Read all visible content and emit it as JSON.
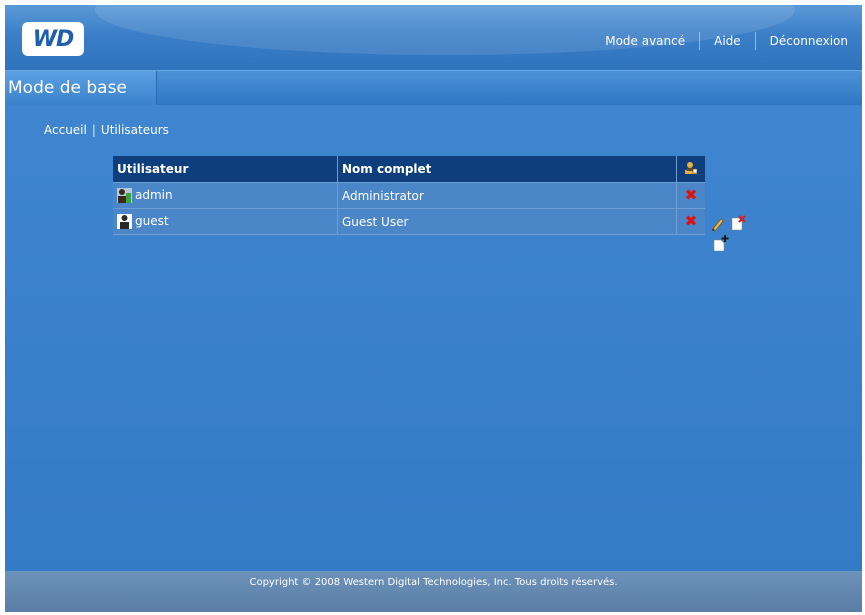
{
  "header": {
    "logo": "WD",
    "nav": [
      "Mode avancé",
      "Aide",
      "Déconnexion"
    ]
  },
  "tabs": [
    {
      "label": "Mode de base",
      "active": true
    }
  ],
  "breadcrumb": [
    "Accueil",
    "Utilisateurs"
  ],
  "users_table": {
    "columns": [
      "Utilisateur",
      "Nom complet"
    ],
    "rows": [
      {
        "user": "admin",
        "full_name": "Administrator",
        "icon": "admin-user-icon"
      },
      {
        "user": "guest",
        "full_name": "Guest User",
        "icon": "guest-user-icon"
      }
    ]
  },
  "footer": {
    "copyright": "Copyright © 2008 Western Digital Technologies, Inc. Tous droits réservés."
  },
  "colors": {
    "background": "#3f84cc",
    "header_table": "#0e3f7c",
    "delete": "#e01010",
    "footer": "#6389b1"
  }
}
